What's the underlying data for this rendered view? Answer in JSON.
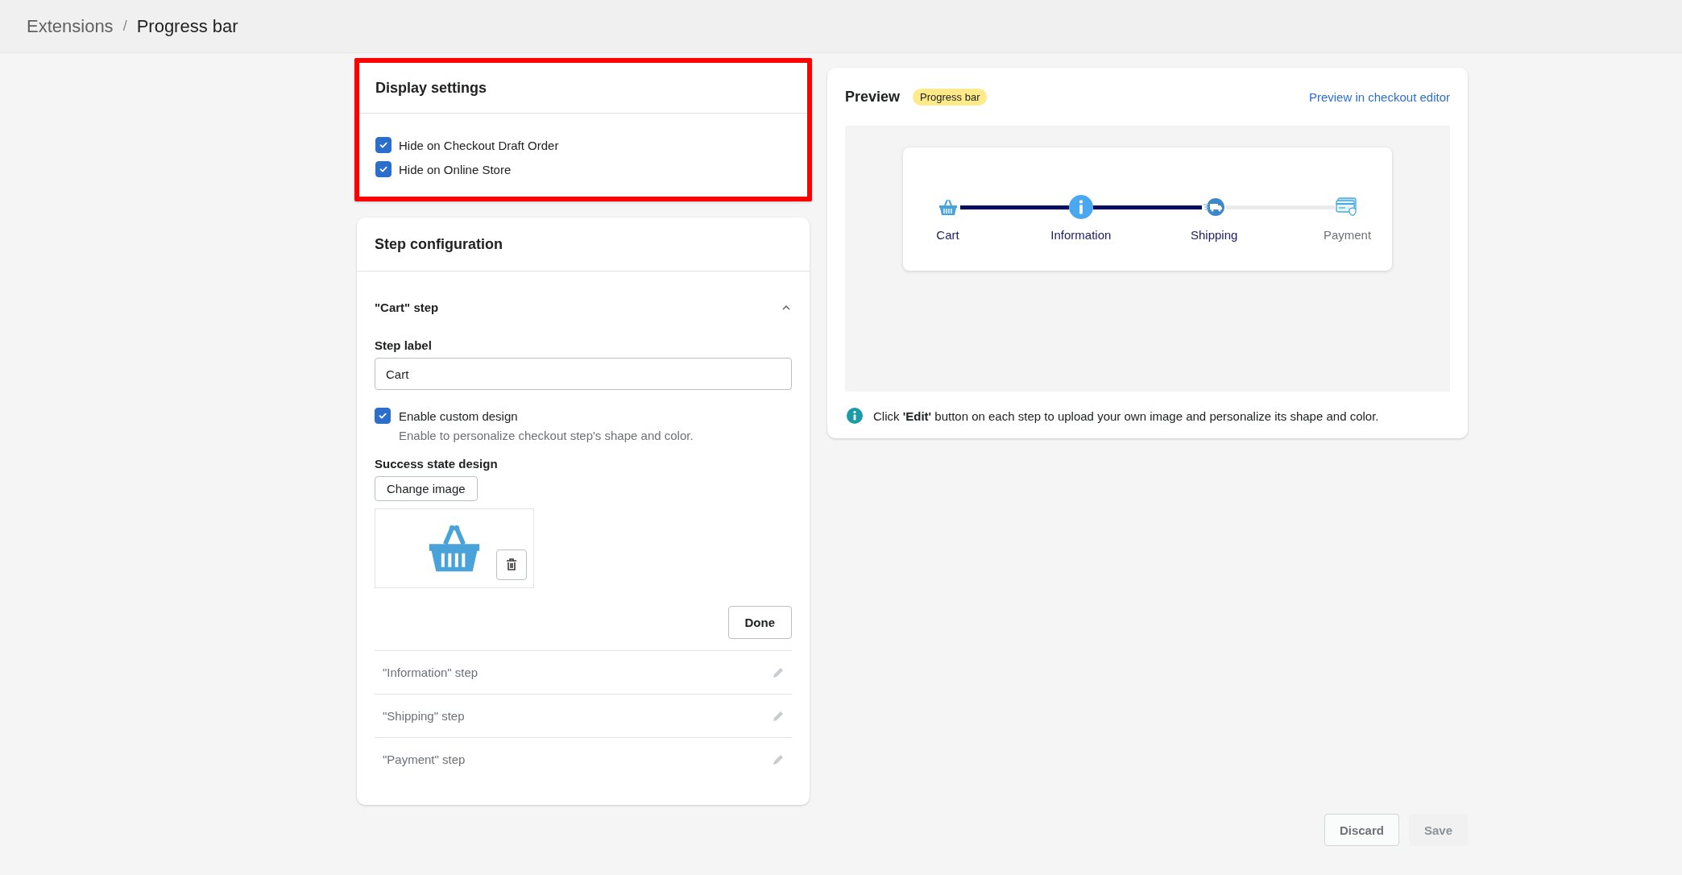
{
  "breadcrumb": [
    {
      "label": "Extensions",
      "kind": "link"
    },
    {
      "label": "/",
      "kind": "separator"
    },
    {
      "label": "Progress bar",
      "kind": "current"
    }
  ],
  "display_settings": {
    "title": "Display settings",
    "highlighted": true,
    "options": [
      {
        "label": "Hide on Checkout Draft Order",
        "checked": true
      },
      {
        "label": "Hide on Online Store",
        "checked": true
      }
    ]
  },
  "step_configuration": {
    "title": "Step configuration",
    "steps": [
      {
        "title": "\"Cart\" step",
        "expanded": true
      },
      {
        "title": "\"Information\" step",
        "expanded": false
      },
      {
        "title": "\"Shipping\" step",
        "expanded": false
      },
      {
        "title": "\"Payment\" step",
        "expanded": false
      }
    ],
    "editor": {
      "step_label": {
        "label": "Step label",
        "value": "Cart"
      },
      "custom_design": {
        "label": "Enable custom design",
        "checked": true,
        "help": "Enable to personalize checkout step's shape and color."
      },
      "success_state": {
        "label": "Success state design",
        "button": "Change image"
      },
      "done_button": "Done"
    }
  },
  "preview": {
    "title": "Preview",
    "badge": "Progress bar",
    "link": "Preview in checkout editor",
    "progress": [
      {
        "label": "Cart",
        "kind": "basket",
        "completed": true
      },
      {
        "label": "Information",
        "kind": "info",
        "completed": true
      },
      {
        "label": "Shipping",
        "kind": "truck",
        "completed": true
      },
      {
        "label": "Payment",
        "kind": "card",
        "completed": false
      }
    ],
    "note": "Click **'Edit'** button on each step to upload your own image and personalize its shape and color."
  },
  "actions": [
    {
      "label": "Discard",
      "disabled": false
    },
    {
      "label": "Save",
      "disabled": true
    }
  ]
}
